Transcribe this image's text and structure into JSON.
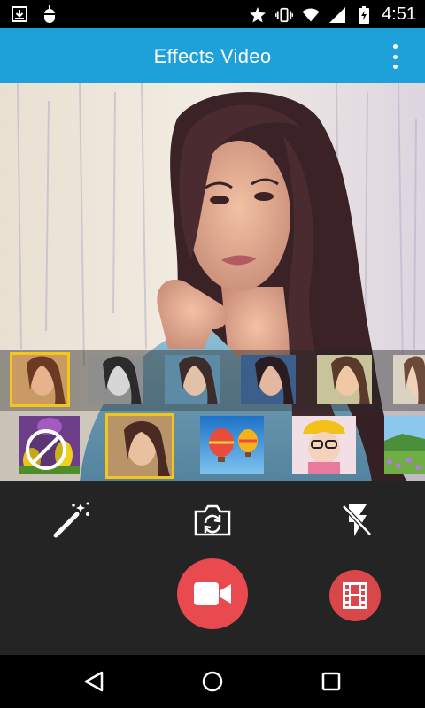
{
  "status_bar": {
    "time": "4:51",
    "left_icons": [
      "download-icon",
      "android-debug-icon"
    ],
    "right_icons": [
      "star-icon",
      "vibrate-icon",
      "wifi-icon",
      "cell-signal-icon",
      "battery-icon"
    ]
  },
  "app_bar": {
    "title": "Effects Video",
    "menu_icon": "overflow-menu-icon",
    "color": "#1ea0d8"
  },
  "effect_filters": {
    "items": [
      "filter-vintage",
      "filter-grayscale",
      "filter-cool",
      "filter-blue",
      "filter-warm",
      "filter-faded"
    ],
    "selected_index": 0,
    "selection_color": "#f5c61a"
  },
  "frame_overlays": {
    "items": [
      "frame-none",
      "frame-portrait",
      "frame-balloons",
      "frame-kid",
      "frame-meadow"
    ],
    "selected_index": 1
  },
  "controls": {
    "magic_wand_icon": "magic-wand-icon",
    "switch_camera_icon": "switch-camera-icon",
    "flash_icon": "flash-off-icon",
    "record_icon": "video-camera-icon",
    "gallery_icon": "film-icon",
    "record_color": "#e84a4f",
    "gallery_color": "#d9474b"
  },
  "nav_bar": {
    "icons": [
      "back-icon",
      "home-icon",
      "recents-icon"
    ]
  }
}
